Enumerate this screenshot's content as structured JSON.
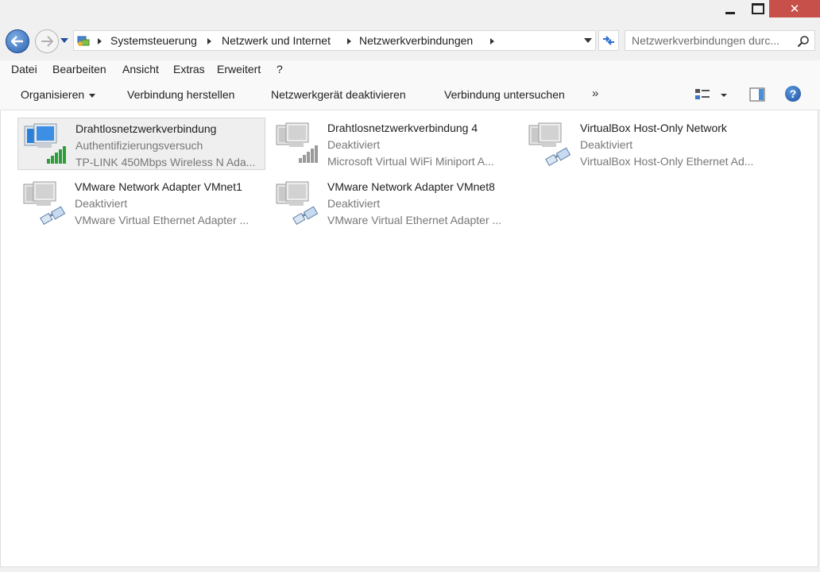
{
  "window": {
    "minimize_icon": "minimize-icon",
    "maximize_icon": "maximize-icon",
    "close_label": "✕"
  },
  "navigation": {
    "breadcrumbs": [
      "Systemsteuerung",
      "Netzwerk und Internet",
      "Netzwerkverbindungen"
    ],
    "search_placeholder": "Netzwerkverbindungen durc..."
  },
  "menu": [
    "Datei",
    "Bearbeiten",
    "Ansicht",
    "Extras",
    "Erweitert",
    "?"
  ],
  "commands": {
    "organize": "Organisieren",
    "connect": "Verbindung herstellen",
    "disable": "Netzwerkgerät deaktivieren",
    "diagnose": "Verbindung untersuchen",
    "more": "»"
  },
  "connections": [
    {
      "name": "Drahtlosnetzwerkverbindung",
      "status": "Authentifizierungsversuch",
      "device": "TP-LINK 450Mbps Wireless N Ada...",
      "icon": "wireless-active-icon",
      "selected": true
    },
    {
      "name": "Drahtlosnetzwerkverbindung 4",
      "status": "Deaktiviert",
      "device": "Microsoft Virtual WiFi Miniport A...",
      "icon": "wireless-disabled-icon",
      "selected": false
    },
    {
      "name": "VirtualBox Host-Only Network",
      "status": "Deaktiviert",
      "device": "VirtualBox Host-Only Ethernet Ad...",
      "icon": "ethernet-disabled-icon",
      "selected": false
    },
    {
      "name": "VMware Network Adapter VMnet1",
      "status": "Deaktiviert",
      "device": "VMware Virtual Ethernet Adapter ...",
      "icon": "ethernet-disabled-icon",
      "selected": false
    },
    {
      "name": "VMware Network Adapter VMnet8",
      "status": "Deaktiviert",
      "device": "VMware Virtual Ethernet Adapter ...",
      "icon": "ethernet-disabled-icon",
      "selected": false
    }
  ],
  "colors": {
    "accent": "#2a5fb0",
    "close": "#c7504a",
    "signal_active": "#2e9e3a",
    "signal_disabled": "#9a9a9a"
  }
}
